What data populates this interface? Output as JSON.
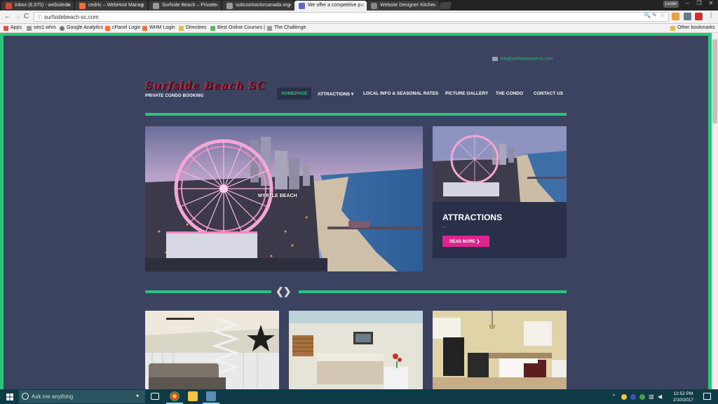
{
  "browser": {
    "tabs": [
      {
        "title": "Inbox (6,975) - websitede",
        "active": false,
        "icon_color": "#d44638"
      },
      {
        "title": "cedric – WebHost Manag",
        "active": false,
        "icon_color": "#ff6c2c"
      },
      {
        "title": "Surfside Beach – Private",
        "active": false,
        "icon_color": "#9a9a9a"
      },
      {
        "title": "subcontractorcanada.org",
        "active": false,
        "icon_color": "#9a9a9a"
      },
      {
        "title": "We offer a competitive p",
        "active": true,
        "icon_color": "#5c6bc0"
      },
      {
        "title": "Website Designer Kitche",
        "active": false,
        "icon_color": "#888"
      }
    ],
    "tab_close": "×",
    "user_label": "Lester",
    "window_controls": [
      "–",
      "❐",
      "✕"
    ],
    "url": "surfsidebeach-sc.com",
    "nav_back": "←",
    "nav_forward": "→",
    "nav_reload": "C",
    "omnibox_icons": [
      "🔍",
      "✎",
      "☆"
    ],
    "bookmarks": [
      {
        "label": "Apps",
        "icon_color": "#e84c3d"
      },
      {
        "label": "seo1 whm",
        "icon_color": "#999"
      },
      {
        "label": "Google Analytics",
        "icon_color": "#777"
      },
      {
        "label": "cPanel Login",
        "icon_color": "#ff6c2c"
      },
      {
        "label": "WHM Login",
        "icon_color": "#ff6c2c"
      },
      {
        "label": "Directires",
        "icon_color": "#e5b94e"
      },
      {
        "label": "Best Online Courses |",
        "icon_color": "#5cb85c"
      },
      {
        "label": "The Challenge",
        "icon_color": "#999"
      }
    ],
    "other_bookmarks": "Other bookmarks"
  },
  "site": {
    "email": "info@surfsidebeach-sc.com",
    "logo_text": "Surfside Beach SC",
    "tagline": "PRIVATE CONDO BOOKING",
    "nav": [
      {
        "label": "HOMEPAGE",
        "active": true
      },
      {
        "label": "ATTRACTIONS ▾",
        "active": false
      },
      {
        "label": "LOCAL INFO & SEASONAL RATES",
        "active": false
      },
      {
        "label": "PICTURE GALLERY",
        "active": false
      },
      {
        "label": "THE CONDO",
        "active": false
      },
      {
        "label": "CONTACT US",
        "active": false
      }
    ],
    "hero_caption": "MYRTLE BEACH",
    "side_title": "ATTRACTIONS",
    "side_excerpt": "...",
    "read_more": "READ MORE  ❯",
    "carousel_arrows": "❮❯",
    "colors": {
      "accent": "#2cc37a",
      "background": "#3b4360",
      "panel": "#2a3049",
      "button": "#e0248f"
    }
  },
  "taskbar": {
    "search_placeholder": "Ask me anything",
    "mic": "🎤",
    "time": "12:52 PM",
    "date": "2/10/2017"
  }
}
